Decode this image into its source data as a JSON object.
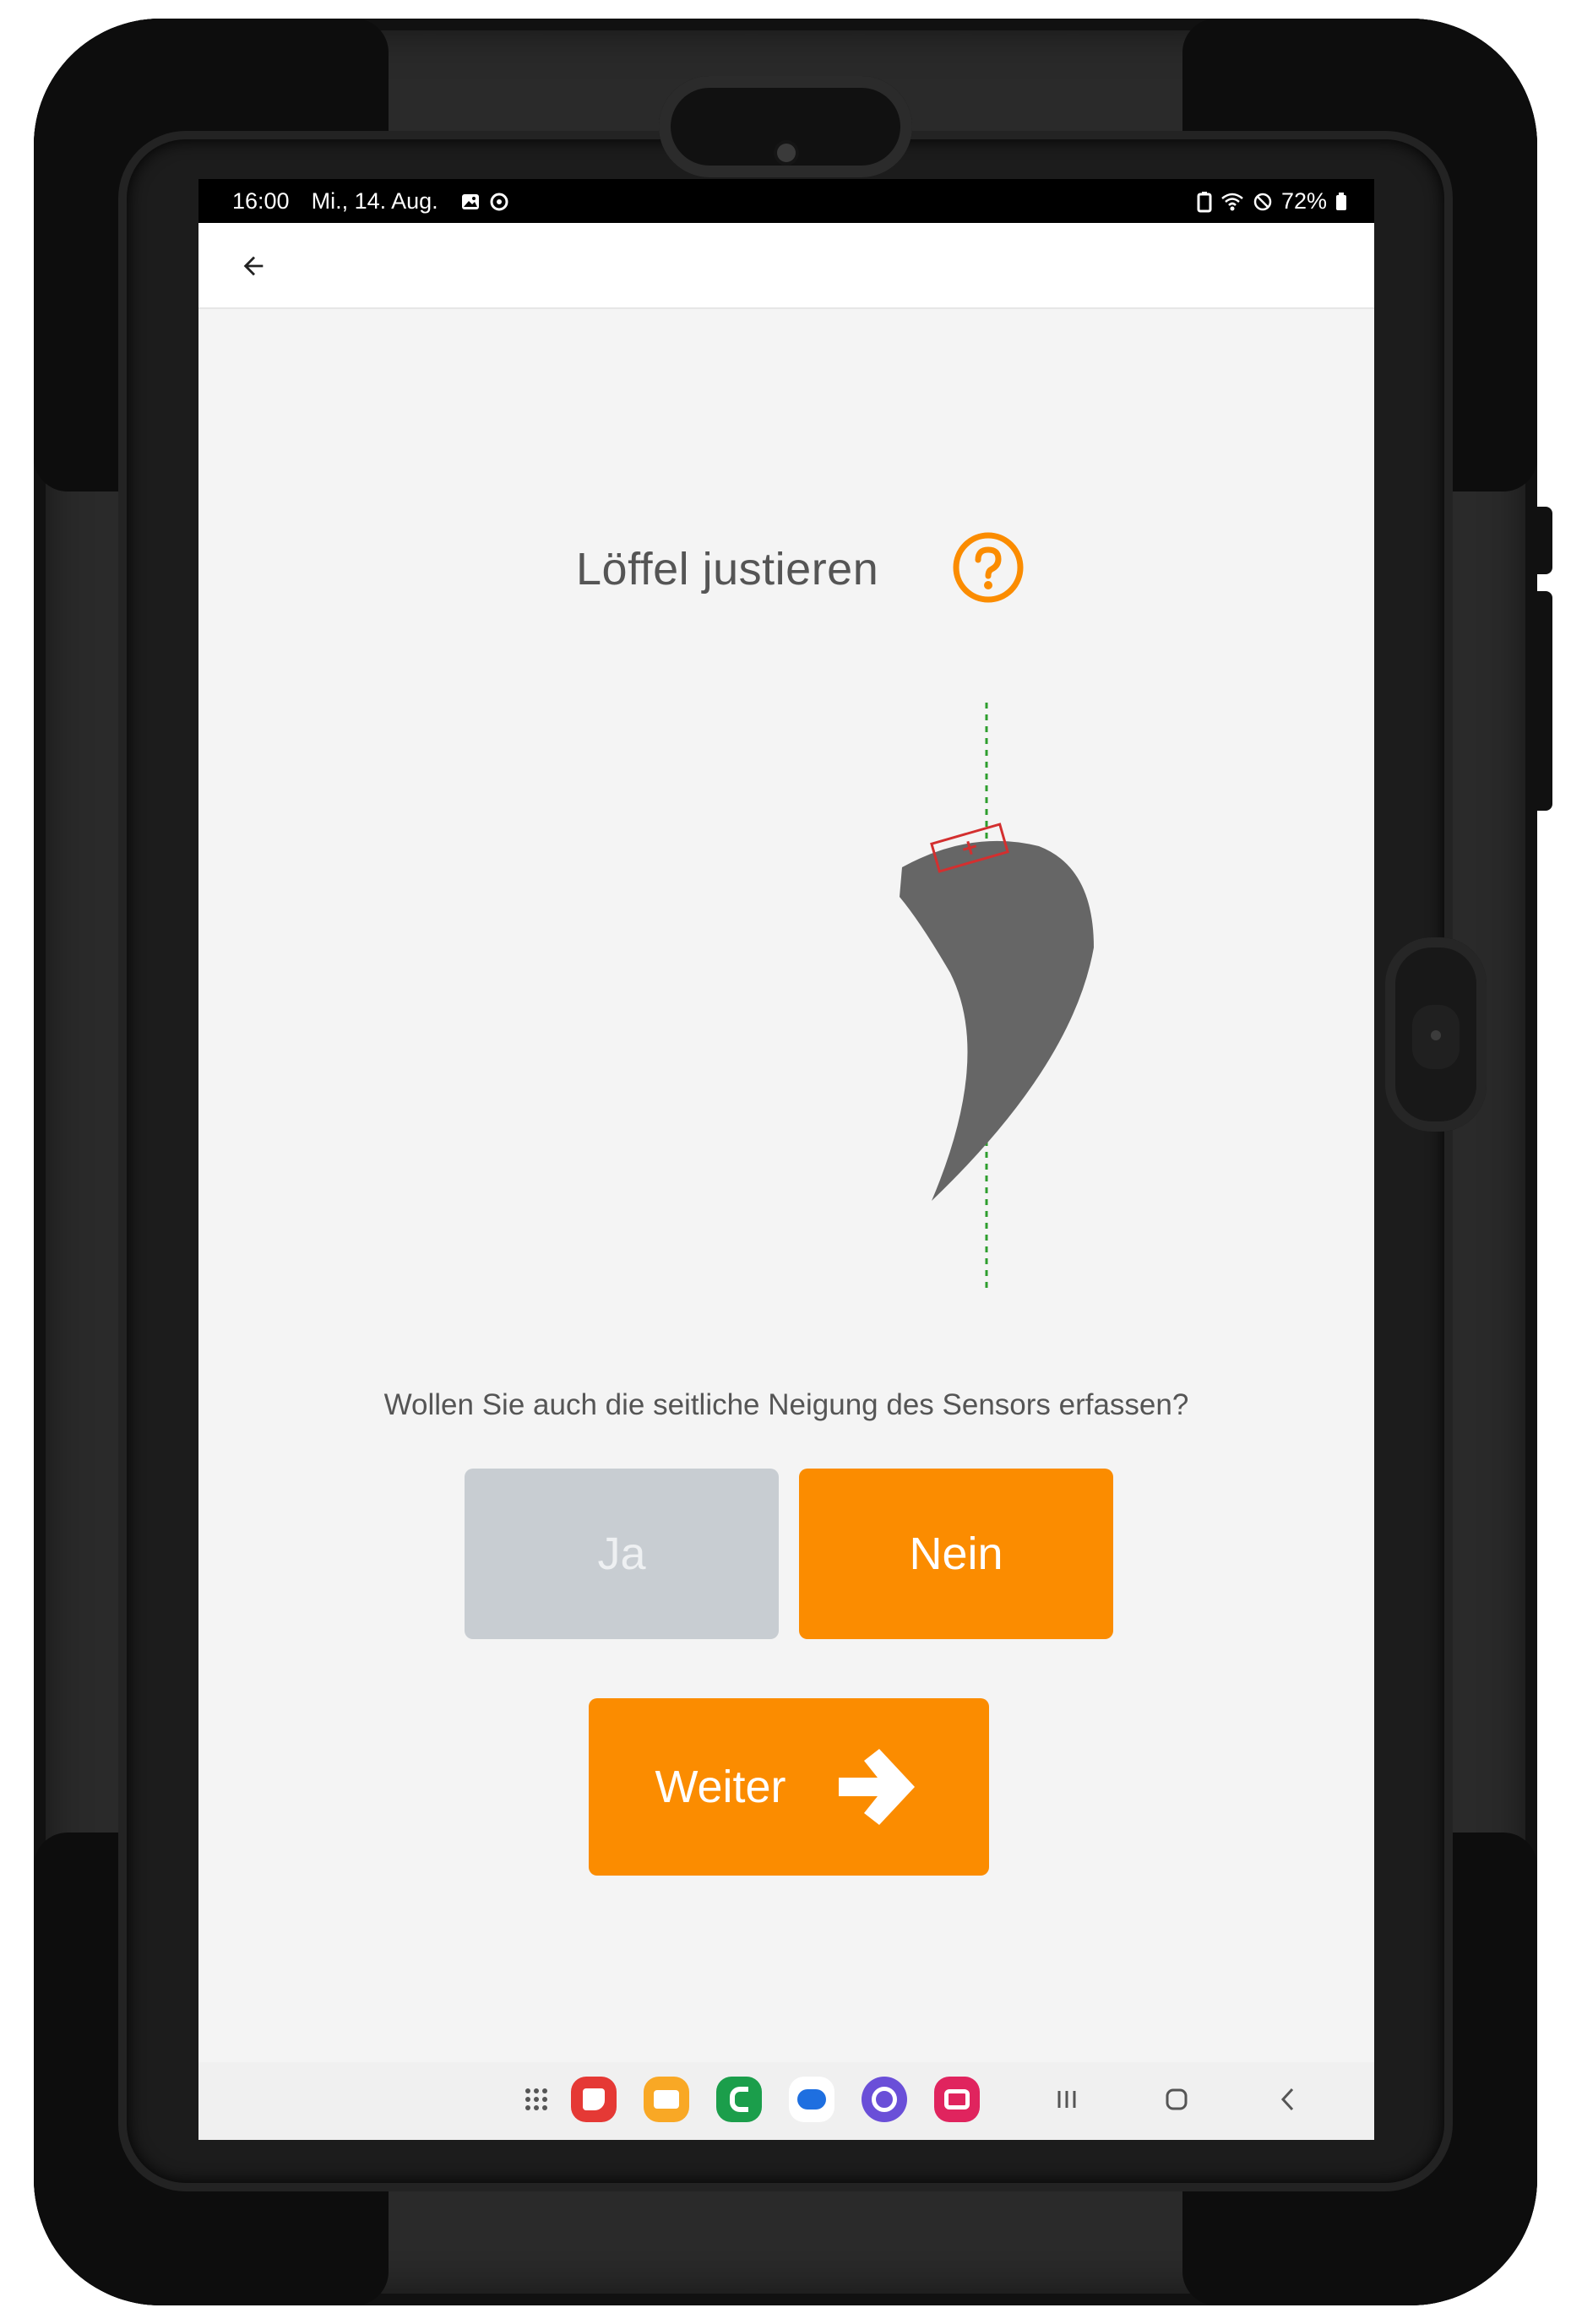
{
  "status_bar": {
    "time": "16:00",
    "date": "Mi., 14. Aug.",
    "battery": "72%",
    "icons": [
      "gallery-icon",
      "sync-icon",
      "battery-saver-icon",
      "wifi-icon",
      "do-not-disturb-icon",
      "battery-icon"
    ]
  },
  "app_bar": {
    "back_icon": "arrow-back-icon"
  },
  "page": {
    "title": "Löffel justieren",
    "help_icon": "question-circle-icon",
    "question": "Wollen Sie auch die seitliche Neigung des Sensors erfassen?",
    "option_yes": "Ja",
    "option_no": "Nein",
    "selected_option": "Nein",
    "next_label": "Weiter",
    "next_icon": "arrow-right-icon"
  },
  "colors": {
    "accent": "#fb8c00",
    "inactive": "#c8cdd2",
    "bucket": "#666666",
    "sensor": "#d32f2f",
    "plumb_line": "#2e9e2e"
  },
  "navigation_bar": {
    "apps": [
      "apps-grid-icon",
      "notes-app-icon",
      "files-app-icon",
      "phone-app-icon",
      "messages-app-icon",
      "browser-app-icon",
      "camera-app-icon"
    ],
    "buttons": [
      "recents-icon",
      "home-icon",
      "back-icon"
    ]
  }
}
